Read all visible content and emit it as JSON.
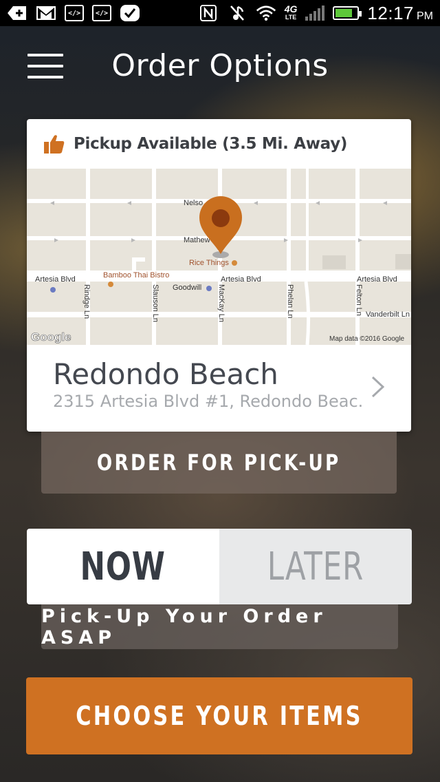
{
  "status_bar": {
    "time": "12:17",
    "ampm": "PM",
    "network": "4G",
    "network_sub": "LTE",
    "battery_level": 0.8,
    "battery_color": "#5ec83a"
  },
  "header": {
    "title": "Order Options",
    "menu_icon": "hamburger-menu-icon"
  },
  "location_card": {
    "pickup_status": "Pickup Available (3.5 Mi. Away)",
    "pickup_icon": "thumbs-up-icon",
    "map": {
      "streets": [
        "Nelso",
        "Mathew",
        "Artesia Blvd",
        "Artesia Blvd",
        "Artesia Blvd",
        "Vanderbilt Ln",
        "Rindge Ln",
        "Slauson Ln",
        "MacKay Ln",
        "Phelan Ln",
        "Felton Ln"
      ],
      "places": [
        "Bamboo Thai Bistro",
        "Rice Things",
        "Goodwill"
      ],
      "logo": "Google",
      "attribution": "Map data ©2016 Google",
      "pin_color": "#c96f1f"
    },
    "location_name": "Redondo  Beach",
    "location_address": "2315 Artesia Blvd #1, Redondo  Beac...",
    "chevron_icon": "chevron-right-icon"
  },
  "pickup_button": {
    "label": "ORDER FOR PICK-UP"
  },
  "timing": {
    "options": [
      "NOW",
      "LATER"
    ],
    "selected": "NOW",
    "description": "Pick-Up Your Order ASAP"
  },
  "cta": {
    "label": "CHOOSE YOUR ITEMS",
    "color": "#cf7122"
  }
}
